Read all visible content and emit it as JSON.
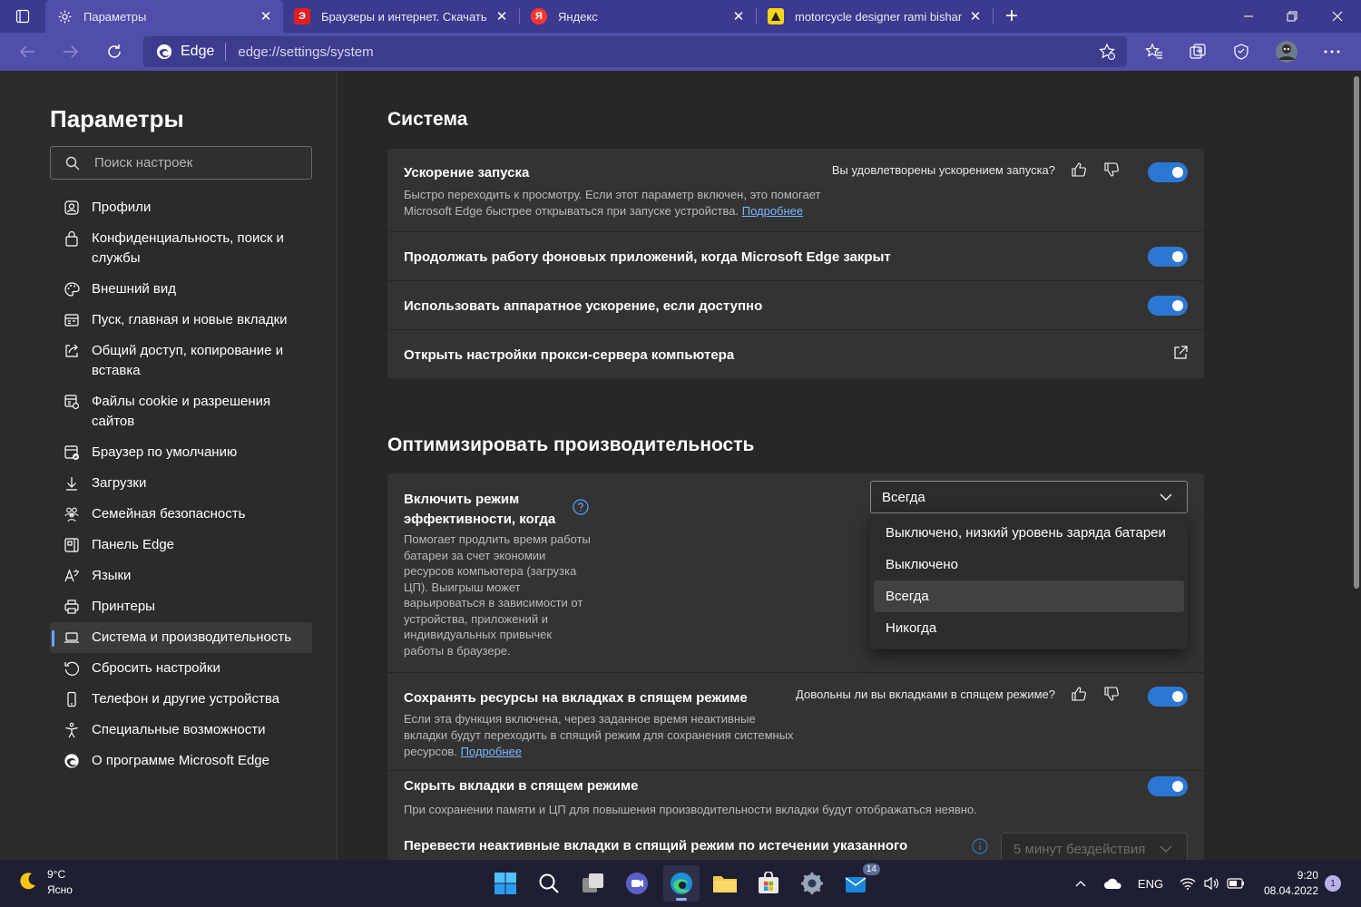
{
  "browser": {
    "tabs": [
      {
        "label": "Параметры",
        "active": true,
        "favicon": "gear-icon"
      },
      {
        "label": "Браузеры и интернет. Скачать",
        "active": false,
        "favicon": "red-square-icon"
      },
      {
        "label": "Яндекс",
        "active": false,
        "favicon": "yandex-icon",
        "favicon_text": "Я"
      },
      {
        "label": "motorcycle designer rami bisharr",
        "active": false,
        "favicon": "yellow-warning-icon"
      }
    ],
    "address": {
      "brand": "Edge",
      "url": "edge://settings/system"
    },
    "colors": {
      "titlebar": "#3b3a8f",
      "toolbar": "#504ea9",
      "accent": "#2b78d4"
    }
  },
  "sidebar": {
    "title": "Параметры",
    "search_placeholder": "Поиск настроек",
    "items": [
      {
        "label": "Профили",
        "icon": "profile-icon"
      },
      {
        "label": "Конфиденциальность, поиск и службы",
        "icon": "lock-icon"
      },
      {
        "label": "Внешний вид",
        "icon": "palette-icon"
      },
      {
        "label": "Пуск, главная и новые вкладки",
        "icon": "home-tabs-icon"
      },
      {
        "label": "Общий доступ, копирование и вставка",
        "icon": "share-icon"
      },
      {
        "label": "Файлы cookie и разрешения сайтов",
        "icon": "cookie-icon"
      },
      {
        "label": "Браузер по умолчанию",
        "icon": "default-browser-icon"
      },
      {
        "label": "Загрузки",
        "icon": "download-icon"
      },
      {
        "label": "Семейная безопасность",
        "icon": "family-icon"
      },
      {
        "label": "Панель Edge",
        "icon": "sidebar-panel-icon"
      },
      {
        "label": "Языки",
        "icon": "language-icon"
      },
      {
        "label": "Принтеры",
        "icon": "printer-icon"
      },
      {
        "label": "Система и производительность",
        "icon": "laptop-icon",
        "active": true
      },
      {
        "label": "Сбросить настройки",
        "icon": "reset-icon"
      },
      {
        "label": "Телефон и другие устройства",
        "icon": "phone-icon"
      },
      {
        "label": "Специальные возможности",
        "icon": "accessibility-icon"
      },
      {
        "label": "О программе Microsoft Edge",
        "icon": "edge-icon"
      }
    ]
  },
  "system": {
    "heading": "Система",
    "startup": {
      "title": "Ускорение запуска",
      "feedback": "Вы удовлетворены ускорением запуска?",
      "desc1": "Быстро переходить к просмотру. Если этот параметр включен, это помогает",
      "desc2": "Microsoft Edge быстрее открываться при запуске устройства.",
      "link": "Подробнее",
      "enabled": true
    },
    "background": {
      "title": "Продолжать работу фоновых приложений, когда Microsoft Edge закрыт",
      "enabled": true
    },
    "hardware": {
      "title": "Использовать аппаратное ускорение, если доступно",
      "enabled": true
    },
    "proxy": {
      "title": "Открыть настройки прокси-сервера компьютера"
    }
  },
  "performance": {
    "heading": "Оптимизировать производительность",
    "efficiency": {
      "title_line1": "Включить режим",
      "title_line2": "эффективности, когда",
      "desc": [
        "Помогает продлить время работы",
        "батареи за счет экономии",
        "ресурсов компьютера (загрузка",
        "ЦП). Выигрыш может",
        "варьироваться в зависимости от",
        "устройства, приложений и",
        "индивидуальных привычек",
        "работы в браузере."
      ],
      "selected": "Всегда",
      "options": [
        "Выключено, низкий уровень заряда батареи",
        "Выключено",
        "Всегда",
        "Никогда"
      ]
    },
    "sleeping": {
      "title": "Сохранять ресурсы на вкладках в спящем режиме",
      "feedback": "Довольны ли вы вкладками в спящем режиме?",
      "desc1": "Если эта функция включена, через заданное время неактивные",
      "desc2": "вкладки будут переходить в спящий режим для сохранения системных",
      "desc3": "ресурсов.",
      "link": "Подробнее",
      "enabled": true
    },
    "fade": {
      "title": "Скрыть вкладки в спящем режиме",
      "desc": "При сохранении памяти и ЦП для повышения производительности вкладки будут отображаться неявно.",
      "enabled": true
    },
    "timeout": {
      "title": "Перевести неактивные вкладки в спящий режим по истечении указанного",
      "value": "5 минут бездействия"
    }
  },
  "taskbar": {
    "weather_temp": "9°C",
    "weather_text": "Ясно",
    "store_badge": "14",
    "lang": "ENG",
    "time": "9:20",
    "date": "08.04.2022",
    "notifications": "1"
  }
}
